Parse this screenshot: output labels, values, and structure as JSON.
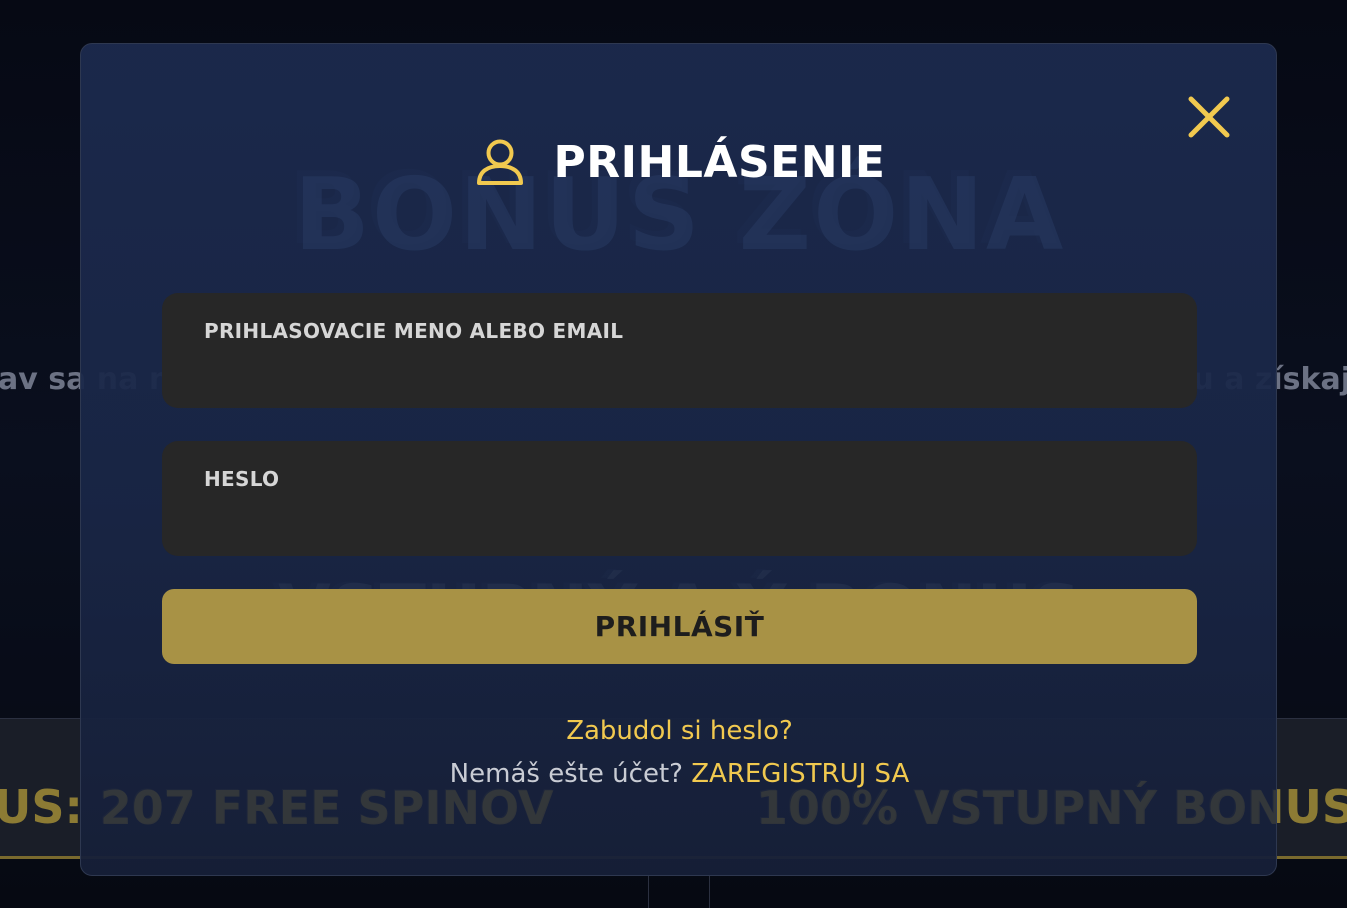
{
  "background": {
    "title": "BONUS ZÓNA",
    "tagline_left": "av sa na n",
    "tagline_right": "u a získaj",
    "subtitle": "VSTUPNÝ A      Ý BONUS",
    "strip_left": "US: 207 FREE SPINOV",
    "strip_right": "100% VSTUPNÝ BONUS"
  },
  "modal": {
    "title": "PRIHLÁSENIE",
    "icons": {
      "user": "user-icon",
      "close": "close-icon"
    },
    "username_field": {
      "label": "PRIHLASOVACIE MENO ALEBO EMAIL",
      "value": ""
    },
    "password_field": {
      "label": "HESLO",
      "value": ""
    },
    "submit_label": "PRIHLÁSIŤ",
    "forgot_label": "Zabudol si heslo?",
    "register_prompt": "Nemáš ešte účet?",
    "register_link": "ZAREGISTRUJ SA"
  },
  "colors": {
    "accent": "#f1c94f",
    "button": "#a89245",
    "field_bg": "#272727",
    "modal_bg": "#1c2a4e"
  }
}
